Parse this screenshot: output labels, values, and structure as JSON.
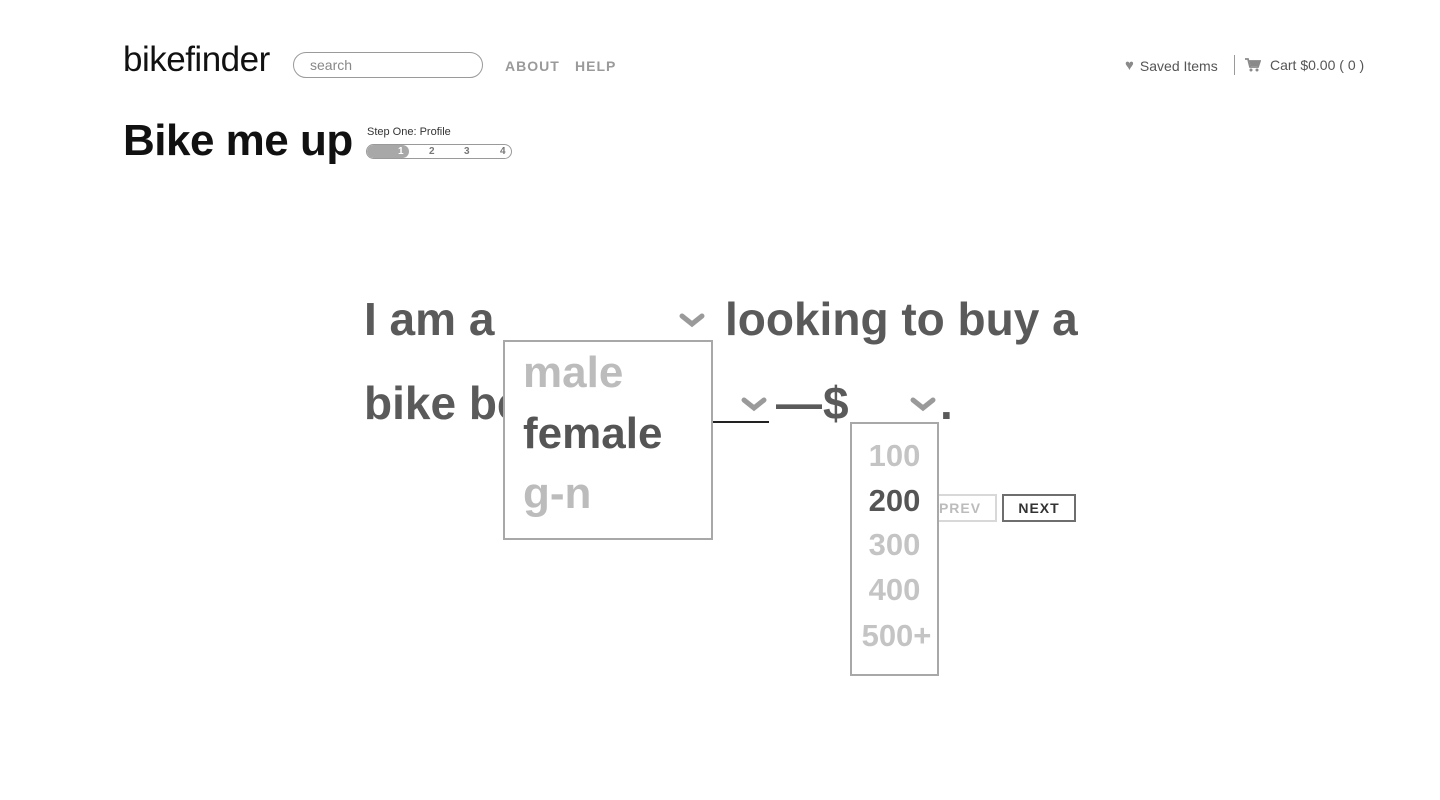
{
  "header": {
    "logo": "bikefinder",
    "search_placeholder": "search",
    "nav": [
      "ABOUT",
      "HELP"
    ],
    "saved_label": "Saved Items",
    "cart_label": "Cart $0.00 ( 0 )"
  },
  "page": {
    "title": "Bike me up",
    "step_label": "Step One: Profile",
    "steps": [
      "1",
      "2",
      "3",
      "4"
    ],
    "current_step": 1
  },
  "sentence": {
    "part1": "I am a",
    "part2": "looking to buy a",
    "part3": "bike be",
    "dash": "—",
    "dollar": "$",
    "period": "."
  },
  "gender_dropdown": {
    "options": [
      "male",
      "female",
      "g-n"
    ],
    "selected": "female"
  },
  "price_dropdown": {
    "options": [
      "100",
      "200",
      "300",
      "400",
      "500+"
    ],
    "selected": "200"
  },
  "buttons": {
    "prev": "PREV",
    "next": "NEXT"
  },
  "colors": {
    "sentence": "#5a5a5a",
    "muted": "#bcbcbc",
    "border": "#a8a8a8"
  }
}
